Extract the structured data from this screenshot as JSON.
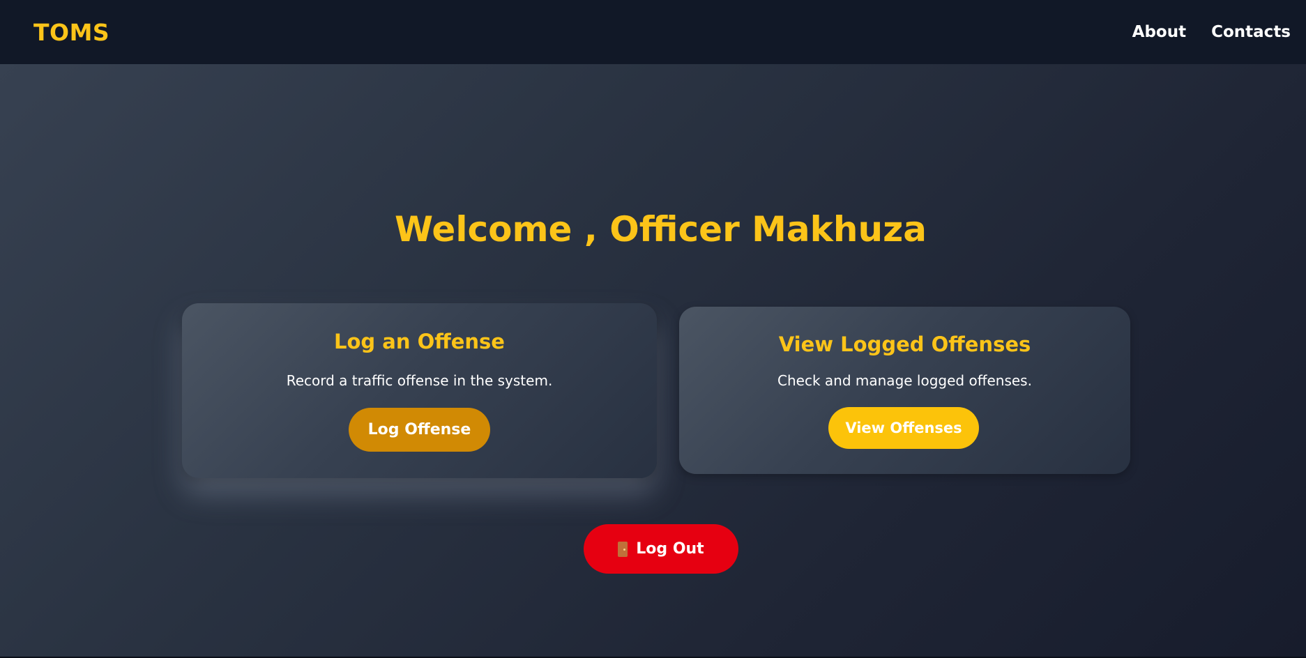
{
  "navbar": {
    "brand": "TOMS",
    "links": [
      "About",
      "Contacts"
    ]
  },
  "hero": {
    "welcome": "Welcome , Officer Makhuza"
  },
  "cards": [
    {
      "title": "Log an Offense",
      "description": "Record a traffic offense in the system.",
      "button_label": "Log Offense"
    },
    {
      "title": "View Logged Offenses",
      "description": "Check and manage logged offenses.",
      "button_label": "View Offenses"
    }
  ],
  "logout": {
    "icon": "door-icon",
    "label": "Log Out"
  },
  "colors": {
    "accent": "#fcc419",
    "navbar_bg": "#111827",
    "logout": "#e60011",
    "log_button": "#d18a04",
    "view_button": "#fcc30a"
  }
}
